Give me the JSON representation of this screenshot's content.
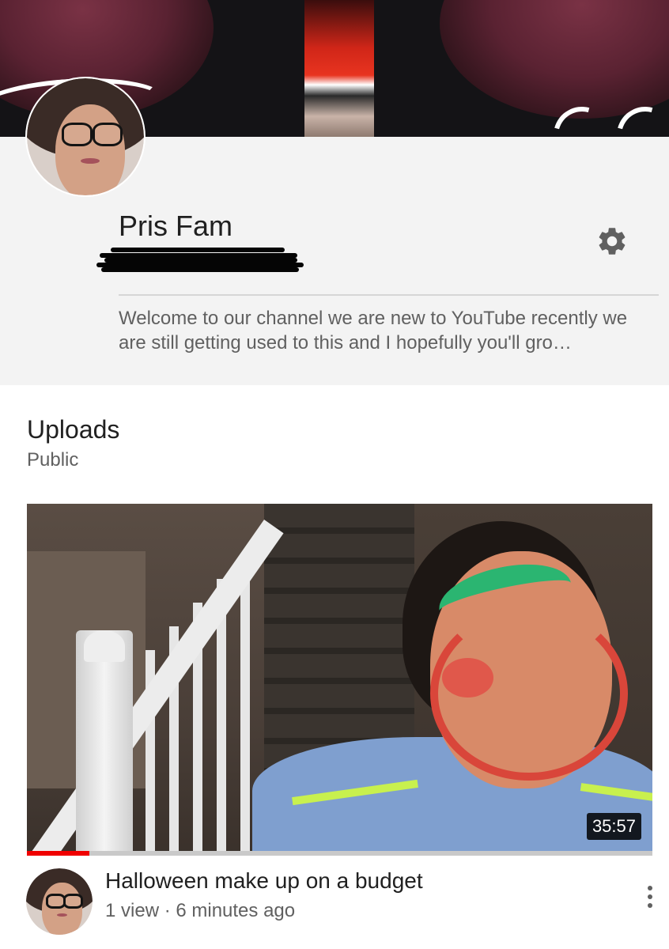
{
  "channel": {
    "name": "Pris Fam",
    "description": "Welcome to our channel we are new to YouTube recently we are still getting used to this and I hopefully you'll gro…"
  },
  "icons": {
    "settings": "gear-icon",
    "more": "more-vert-icon"
  },
  "uploads": {
    "title": "Uploads",
    "visibility": "Public"
  },
  "video": {
    "title": "Halloween make up on a budget",
    "meta": "1 view · 6 minutes ago",
    "duration": "35:57",
    "watch_progress": 0.1
  },
  "colors": {
    "header_bg": "#f3f3f3",
    "progress": "#f00000",
    "text_primary": "#202020",
    "text_secondary": "#606060"
  }
}
